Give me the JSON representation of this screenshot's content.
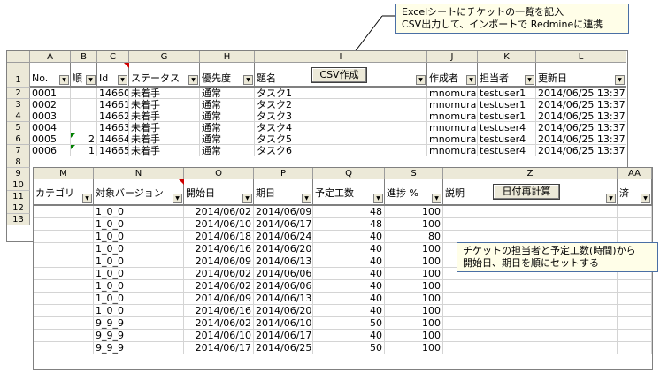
{
  "callout_top": "Excelシートにチケットの一覧を記入\nCSV出力して、インポートで Redmineに連携",
  "callout_mid": "チケットの担当者と予定工数(時間)から\n開始日、期日を順にセットする",
  "sheet1": {
    "columns": [
      "A",
      "B",
      "C",
      "G",
      "H",
      "I",
      "J",
      "K",
      "L"
    ],
    "headers": [
      "No.",
      "順",
      "Id",
      "ステータス",
      "優先度",
      "題名",
      "作成者",
      "担当者",
      "更新日"
    ],
    "header_row_num": "1",
    "csv_button": "CSV作成",
    "row_numbers": [
      "2",
      "3",
      "4",
      "5",
      "6",
      "7",
      "8",
      "9",
      "10",
      "11",
      "12",
      "13"
    ],
    "rows": [
      [
        "0001",
        "",
        "14660",
        "未着手",
        "通常",
        "タスク1",
        "mnomura",
        "testuser1",
        "2014/06/25 13:37"
      ],
      [
        "0002",
        "",
        "14661",
        "未着手",
        "通常",
        "タスク2",
        "mnomura",
        "testuser1",
        "2014/06/25 13:37"
      ],
      [
        "0003",
        "",
        "14662",
        "未着手",
        "通常",
        "タスク3",
        "mnomura",
        "testuser1",
        "2014/06/25 13:37"
      ],
      [
        "0004",
        "",
        "14663",
        "未着手",
        "通常",
        "タスク4",
        "mnomura",
        "testuser4",
        "2014/06/25 13:37"
      ],
      [
        "0005",
        "2",
        "14664",
        "未着手",
        "通常",
        "タスク5",
        "mnomura",
        "testuser4",
        "2014/06/25 13:37"
      ],
      [
        "0006",
        "1",
        "14665",
        "未着手",
        "通常",
        "タスク6",
        "mnomura",
        "testuser4",
        "2014/06/25 13:37"
      ]
    ]
  },
  "sheet2": {
    "columns": [
      "M",
      "N",
      "O",
      "P",
      "Q",
      "S",
      "Z",
      "AA"
    ],
    "headers": [
      "カテゴリ",
      "対象バージョン",
      "開始日",
      "期日",
      "予定工数",
      "進捗 %",
      "説明",
      "済"
    ],
    "recalc_button": "日付再計算",
    "rows": [
      [
        "",
        "1_0_0",
        "2014/06/02",
        "2014/06/09",
        "48",
        "100"
      ],
      [
        "",
        "1_0_0",
        "2014/06/10",
        "2014/06/17",
        "48",
        "100"
      ],
      [
        "",
        "1_0_0",
        "2014/06/18",
        "2014/06/24",
        "40",
        "80"
      ],
      [
        "",
        "1_0_0",
        "2014/06/16",
        "2014/06/20",
        "40",
        "100"
      ],
      [
        "",
        "1_0_0",
        "2014/06/09",
        "2014/06/13",
        "40",
        "100"
      ],
      [
        "",
        "1_0_0",
        "2014/06/02",
        "2014/06/06",
        "40",
        "100"
      ],
      [
        "",
        "1_0_0",
        "2014/06/02",
        "2014/06/06",
        "40",
        "100"
      ],
      [
        "",
        "1_0_0",
        "2014/06/09",
        "2014/06/13",
        "40",
        "100"
      ],
      [
        "",
        "1_0_0",
        "2014/06/16",
        "2014/06/20",
        "40",
        "100"
      ],
      [
        "",
        "9_9_9",
        "2014/06/02",
        "2014/06/10",
        "50",
        "100"
      ],
      [
        "",
        "9_9_9",
        "2014/06/10",
        "2014/06/17",
        "40",
        "100"
      ],
      [
        "",
        "9_9_9",
        "2014/06/17",
        "2014/06/25",
        "50",
        "100"
      ]
    ]
  }
}
